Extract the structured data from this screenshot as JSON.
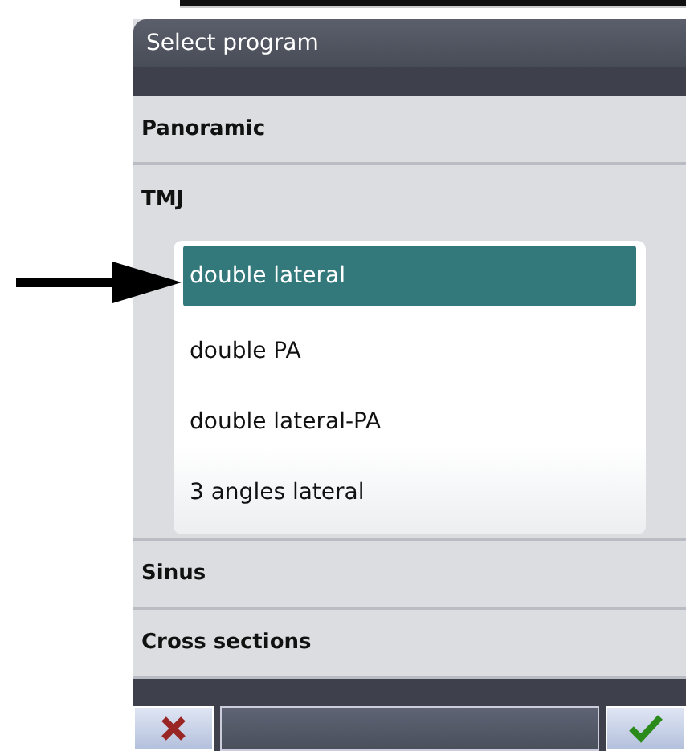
{
  "dialog": {
    "title": "Select program"
  },
  "categories": [
    {
      "label": "Panoramic",
      "expanded": false
    },
    {
      "label": "TMJ",
      "expanded": true,
      "children": [
        {
          "label": "double lateral",
          "selected": true
        },
        {
          "label": "double PA",
          "selected": false
        },
        {
          "label": "double lateral-PA",
          "selected": false
        },
        {
          "label": "3 angles lateral",
          "selected": false
        }
      ]
    },
    {
      "label": "Sinus",
      "expanded": false
    },
    {
      "label": "Cross sections",
      "expanded": false
    }
  ],
  "buttons": [
    {
      "kind": "cancel"
    },
    {
      "kind": "field"
    },
    {
      "kind": "ok"
    }
  ]
}
